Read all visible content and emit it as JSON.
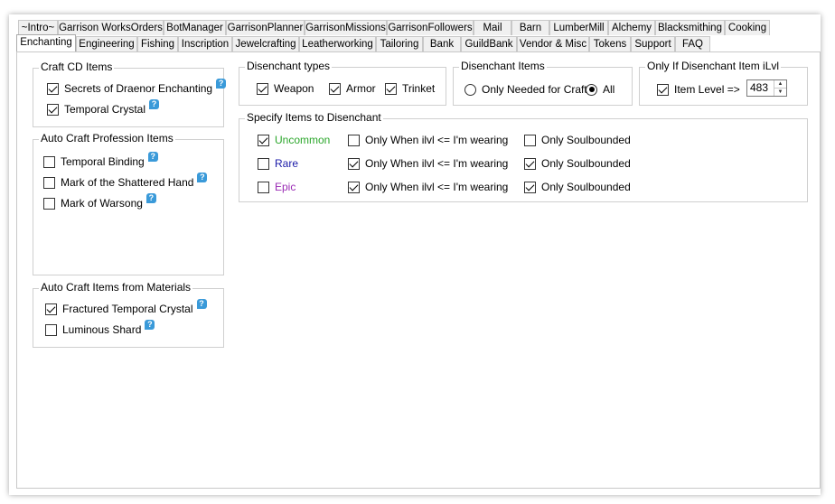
{
  "tabs_row1": [
    "~Intro~",
    "Garrison WorksOrders",
    "BotManager",
    "GarrisonPlanner",
    "GarrisonMissions",
    "GarrisonFollowers",
    "Mail",
    "Barn",
    "LumberMill",
    "Alchemy",
    "Blacksmithing",
    "Cooking"
  ],
  "tabs_row2": [
    "Enchanting",
    "Engineering",
    "Fishing",
    "Inscription",
    "Jewelcrafting",
    "Leatherworking",
    "Tailoring",
    "Bank",
    "GuildBank",
    "Vendor & Misc",
    "Tokens",
    "Support",
    "FAQ"
  ],
  "help_glyph": "?",
  "craft_cd": {
    "title": "Craft CD Items",
    "items": [
      {
        "label": "Secrets of Draenor Enchanting",
        "checked": true
      },
      {
        "label": "Temporal Crystal",
        "checked": true
      }
    ]
  },
  "auto_prof": {
    "title": "Auto Craft Profession Items",
    "items": [
      {
        "label": "Temporal Binding",
        "checked": false
      },
      {
        "label": "Mark of the Shattered Hand",
        "checked": false
      },
      {
        "label": "Mark of Warsong",
        "checked": false
      }
    ]
  },
  "auto_mat": {
    "title": "Auto Craft Items from Materials",
    "items": [
      {
        "label": "Fractured Temporal Crystal",
        "checked": true
      },
      {
        "label": "Luminous Shard",
        "checked": false
      }
    ]
  },
  "de_types": {
    "title": "Disenchant types",
    "items": [
      {
        "label": "Weapon",
        "checked": true
      },
      {
        "label": "Armor",
        "checked": true
      },
      {
        "label": "Trinket",
        "checked": true
      }
    ]
  },
  "de_items": {
    "title": "Disenchant Items",
    "opt1": "Only Needed for Craft",
    "opt2": "All",
    "selected": "All"
  },
  "de_ilvl": {
    "title": "Only If Disenchant Item iLvl",
    "label": "Item Level =>",
    "checked": true,
    "value": "483"
  },
  "specify": {
    "title": "Specify Items to Disenchant",
    "colors": {
      "Uncommon": "#2aa62a",
      "Rare": "#1a1aa8",
      "Epic": "#9a2bb5"
    },
    "rows": [
      {
        "quality": "Uncommon",
        "checked": true,
        "ilvl_label": "Only When ilvl <= I'm wearing",
        "ilvl": false,
        "soul_label": "Only Soulbounded",
        "soul": false
      },
      {
        "quality": "Rare",
        "checked": false,
        "ilvl_label": "Only When ilvl <= I'm wearing",
        "ilvl": true,
        "soul_label": "Only Soulbounded",
        "soul": true
      },
      {
        "quality": "Epic",
        "checked": false,
        "ilvl_label": "Only When ilvl <= I'm wearing",
        "ilvl": true,
        "soul_label": "Only Soulbounded",
        "soul": true
      }
    ]
  }
}
